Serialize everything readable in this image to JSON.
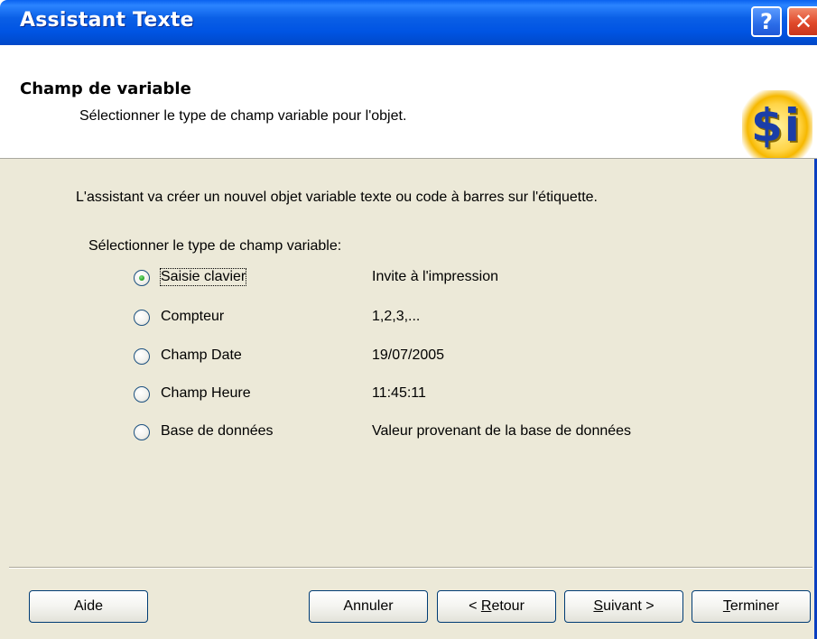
{
  "window": {
    "title": "Assistant Texte",
    "help_label": "?",
    "close_label": "✕"
  },
  "header": {
    "title": "Champ de variable",
    "subtitle": "Sélectionner le type de champ variable pour l'objet.",
    "logo_text": "$i"
  },
  "body": {
    "intro": "L'assistant va créer un nouvel objet variable texte ou code à barres sur l'étiquette.",
    "select_label": "Sélectionner le type de champ variable:",
    "options": [
      {
        "label": "Saisie clavier",
        "description": "Invite à l'impression",
        "checked": true
      },
      {
        "label": "Compteur",
        "description": "1,2,3,...",
        "checked": false
      },
      {
        "label": "Champ Date",
        "description": "19/07/2005",
        "checked": false
      },
      {
        "label": "Champ Heure",
        "description": "11:45:11",
        "checked": false
      },
      {
        "label": "Base de données",
        "description": "Valeur provenant de la base de données",
        "checked": false
      }
    ]
  },
  "footer": {
    "help": "Aide",
    "cancel": "Annuler",
    "back_prefix": "< ",
    "back_mnemonic": "R",
    "back_rest": "etour",
    "next_mnemonic": "S",
    "next_rest": "uivant >",
    "finish_mnemonic": "T",
    "finish_rest": "erminer"
  },
  "colors": {
    "titlebar": "#0054e3",
    "dialog_bg": "#ece9d8",
    "logo_text": "#1b3ea8",
    "logo_glow": "#ffd447"
  }
}
